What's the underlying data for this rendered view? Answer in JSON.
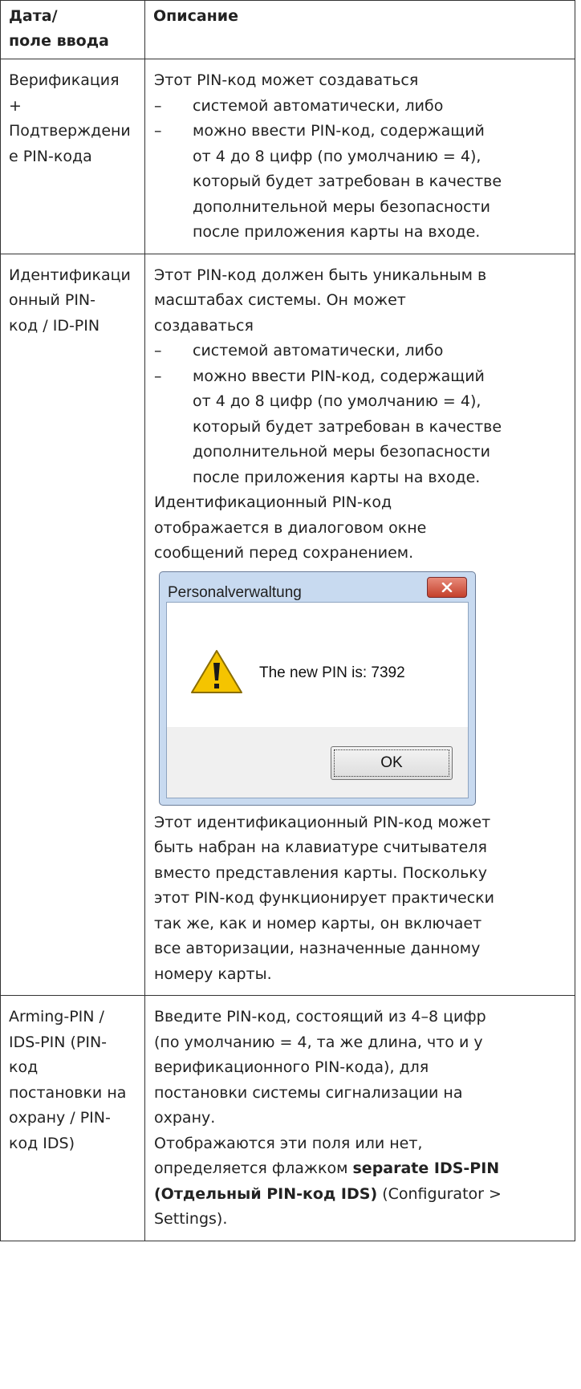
{
  "header": {
    "col1_line1": "Дата/",
    "col1_line2": "поле ввода",
    "col2": "Описание"
  },
  "rows": [
    {
      "field": [
        "Верификация",
        "+",
        "Подтверждени",
        "е PIN-кода"
      ],
      "desc_intro": "Этот PIN-код может создаваться",
      "bullets": {
        "b1": "системой автоматически, либо",
        "b2_lines": [
          "можно ввести PIN-код, содержащий",
          "от 4 до 8 цифр (по умолчанию = 4),",
          "который будет затребован в качестве",
          "дополнительной меры безопасности",
          "после приложения карты на входе."
        ]
      }
    },
    {
      "field": [
        "Идентификаци",
        "онный PIN-",
        "код / ID-PIN"
      ],
      "desc_intro_lines": [
        "Этот PIN-код должен быть уникальным в",
        "масштабах системы. Он может",
        "создаваться"
      ],
      "bullets": {
        "b1": "системой автоматически, либо",
        "b2_lines": [
          "можно ввести PIN-код, содержащий",
          "от 4 до 8 цифр (по умолчанию = 4),",
          "который будет затребован в качестве",
          "дополнительной меры безопасности",
          "после приложения карты на входе."
        ]
      },
      "after_lines": [
        "Идентификационный PIN-код",
        "отображается в диалоговом окне",
        "сообщений перед сохранением."
      ],
      "dialog": {
        "title": "Personalverwaltung",
        "message": "The new PIN is: 7392",
        "ok_label": "OK"
      },
      "final_lines": [
        "Этот идентификационный PIN-код может",
        "быть набран на клавиатуре считывателя",
        "вместо представления карты. Поскольку",
        "этот PIN-код функционирует практически",
        "так же, как и номер карты, он включает",
        "все авторизации, назначенные данному",
        "номеру карты."
      ]
    },
    {
      "field": [
        "Arming-PIN /",
        "IDS-PIN (PIN-",
        "код",
        "постановки на",
        "охрану / PIN-",
        "код IDS)"
      ],
      "desc_lines": [
        "Введите PIN-код, состоящий из 4–8 цифр",
        "(по умолчанию = 4, та же длина, что и у",
        "верификационного PIN-кода), для",
        "постановки системы сигнализации на",
        "охрану.",
        "Отображаются эти поля или нет,"
      ],
      "mixed_line1": {
        "pre": "определяется флажком ",
        "bold": "separate IDS-PIN"
      },
      "mixed_line2": {
        "bold": "(Отдельный PIN-код IDS)",
        "post": " (Configurator >"
      },
      "last_line": "Settings)."
    }
  ],
  "dash": "–",
  "icons": {
    "dialog_close": "close-x-icon",
    "dialog_warning": "warning-triangle-icon"
  },
  "colors": {
    "close_button": "#c4402b",
    "dialog_frame": "#c8daf0",
    "warning": "#f5c400"
  }
}
